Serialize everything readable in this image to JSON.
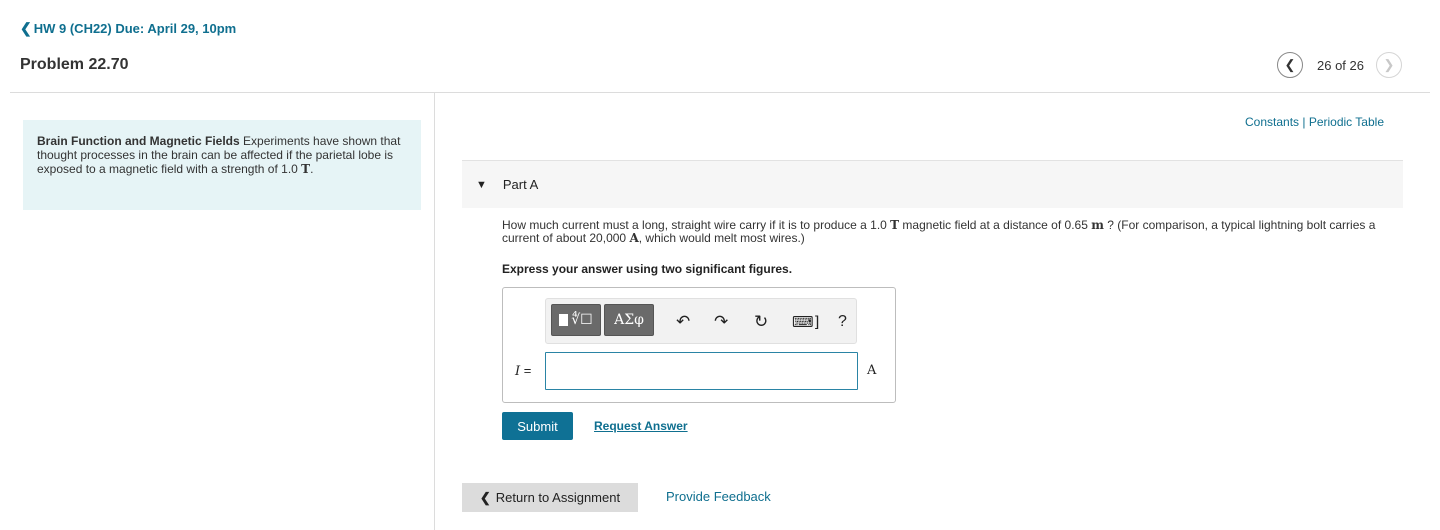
{
  "header": {
    "back_chevron": "❮",
    "back_label": "HW 9 (CH22) Due: April 29, 10pm",
    "problem_title": "Problem 22.70",
    "pager": {
      "prev": "❮",
      "next": "❯",
      "text": "26 of 26"
    }
  },
  "intro": {
    "heading": "Brain Function and Magnetic Fields",
    "body": " Experiments have shown that thought processes in the brain can be affected if the parietal lobe is exposed to a magnetic field with a strength of 1.0 ",
    "unit": "T",
    "end": "."
  },
  "links": {
    "constants": "Constants",
    "separator": " | ",
    "periodic_table": "Periodic Table"
  },
  "part": {
    "toggle_icon": "▼",
    "label": "Part A",
    "question": {
      "p1": "How much current must a long, straight wire carry if it is to produce a 1.0 ",
      "u1": "T",
      "p2": " magnetic field at a distance of 0.65 ",
      "u2": "m",
      "p3": " ? (For comparison, a typical lightning bolt carries a current of about 20,000 ",
      "u3": "A",
      "p4": ", which would melt most wires.)"
    },
    "instruction": "Express your answer using two significant figures."
  },
  "toolbar": {
    "templates_radical": "∜☐",
    "symbols_label": "ΑΣφ",
    "undo_icon": "↶",
    "redo_icon": "↷",
    "reset_icon": "↻",
    "keyboard_icon": "⌨]",
    "help_label": "?"
  },
  "answer": {
    "variable": "I",
    "equals": " =",
    "value": "",
    "unit": "A"
  },
  "actions": {
    "submit": "Submit",
    "request_answer": "Request Answer",
    "return_chevron": "❮",
    "return_label": "Return to Assignment",
    "feedback": "Provide Feedback"
  }
}
